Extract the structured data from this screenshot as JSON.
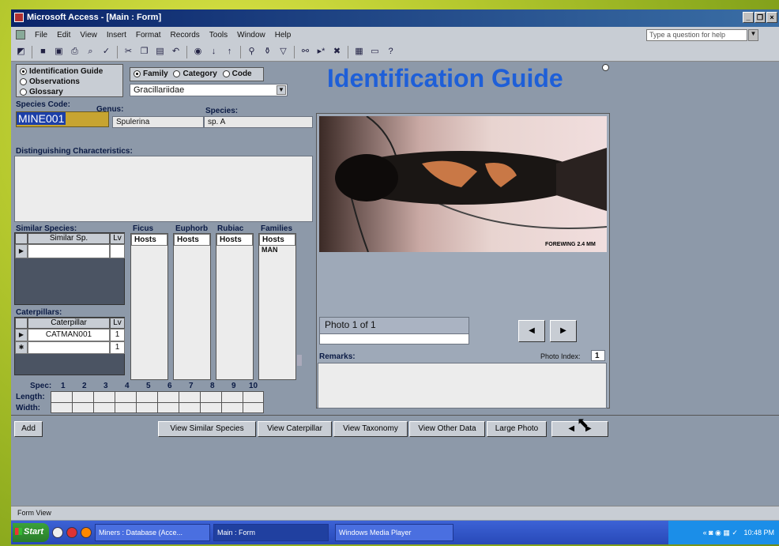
{
  "window": {
    "title": "Microsoft Access - [Main : Form]"
  },
  "menu": {
    "items": [
      "File",
      "Edit",
      "View",
      "Insert",
      "Format",
      "Records",
      "Tools",
      "Window",
      "Help"
    ],
    "help_placeholder": "Type a question for help"
  },
  "nav": {
    "options": [
      "Identification Guide",
      "Observations",
      "Glossary"
    ]
  },
  "search_by": {
    "options": [
      "Family",
      "Category",
      "Code"
    ],
    "value": "Gracillariidae"
  },
  "header": {
    "title": "Identification Guide"
  },
  "species": {
    "code_label": "Species Code:",
    "code": "MINE001",
    "genus_label": "Genus:",
    "genus": "Spulerina",
    "species_label": "Species:",
    "species": "sp. A",
    "distinguishing_label": "Distinguishing Characteristics:"
  },
  "similar": {
    "label": "Similar Species:",
    "col1": "Similar Sp.",
    "col2": "Lv"
  },
  "hosts": {
    "columns": [
      {
        "label": "Ficus",
        "header": "Hosts",
        "rows": []
      },
      {
        "label": "Euphorb",
        "header": "Hosts",
        "rows": []
      },
      {
        "label": "Rubiac",
        "header": "Hosts",
        "rows": []
      },
      {
        "label": "Families",
        "header": "Hosts",
        "rows": [
          "MAN"
        ]
      }
    ]
  },
  "caterpillars": {
    "label": "Caterpillars:",
    "col1": "Caterpillar",
    "col2": "Lv",
    "rows": [
      {
        "code": "CATMAN001",
        "lv": "1"
      },
      {
        "code": "",
        "lv": "1"
      }
    ]
  },
  "spec": {
    "label": "Spec:",
    "numbers": [
      "1",
      "2",
      "3",
      "4",
      "5",
      "6",
      "7",
      "8",
      "9",
      "10"
    ],
    "length_label": "Length:",
    "width_label": "Width:"
  },
  "photo": {
    "caption": "FOREWING 2.4 MM",
    "counter": "Photo 1 of 1",
    "remarks_label": "Remarks:",
    "index_label": "Photo Index:",
    "index": "1"
  },
  "buttons": {
    "add": "Add",
    "similar": "View Similar Species",
    "caterpillar": "View Caterpillar",
    "taxonomy": "View Taxonomy",
    "other": "View Other Data",
    "large": "Large Photo"
  },
  "status": {
    "text": "Form View"
  },
  "taskbar": {
    "start": "Start",
    "tasks": [
      "Miners : Database (Acce...",
      "Main : Form",
      "Windows Media Player"
    ],
    "clock": "10:48 PM"
  },
  "colors": {
    "title_blue": "#1e5fd8",
    "code_highlight": "#1c3fa8"
  }
}
